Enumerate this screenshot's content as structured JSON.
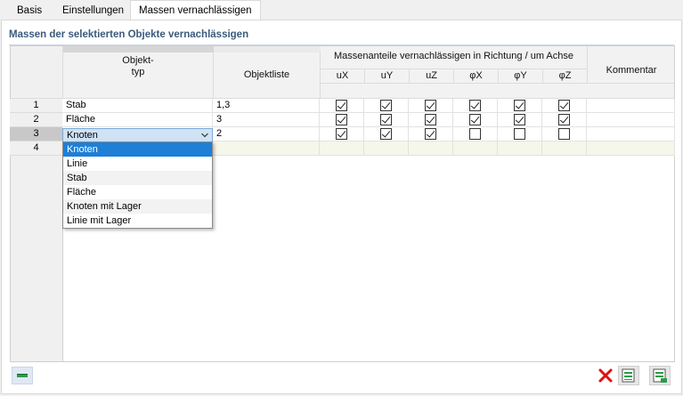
{
  "tabs": [
    {
      "label": "Basis",
      "active": false
    },
    {
      "label": "Einstellungen",
      "active": false
    },
    {
      "label": "Massen vernachlässigen",
      "active": true
    }
  ],
  "section_title": "Massen der selektierten Objekte vernachlässigen",
  "table": {
    "headers": {
      "objekttyp": "Objekt-\ntyp",
      "objektliste": "Objektliste",
      "group": "Massenanteile vernachlässigen in Richtung / um Achse",
      "ux": "uX",
      "uy": "uY",
      "uz": "uZ",
      "phix": "φX",
      "phiy": "φY",
      "phiz": "φZ",
      "kommentar": "Kommentar"
    },
    "rows": [
      {
        "num": "1",
        "typ": "Stab",
        "liste": "1,3",
        "checks": [
          true,
          true,
          true,
          true,
          true,
          true
        ],
        "kommentar": ""
      },
      {
        "num": "2",
        "typ": "Fläche",
        "liste": "3",
        "checks": [
          true,
          true,
          true,
          true,
          true,
          true
        ],
        "kommentar": ""
      },
      {
        "num": "3",
        "typ": "Knoten",
        "liste": "2",
        "checks": [
          true,
          true,
          true,
          false,
          false,
          false
        ],
        "kommentar": ""
      },
      {
        "num": "4",
        "typ": "",
        "liste": "",
        "checks": null,
        "kommentar": ""
      }
    ]
  },
  "combo": {
    "value": "Knoten"
  },
  "dropdown_options": [
    "Knoten",
    "Linie",
    "Stab",
    "Fläche",
    "Knoten mit Lager",
    "Linie mit Lager"
  ],
  "dropdown_selected": "Knoten",
  "colors": {
    "accent": "#1e7fd6",
    "title": "#3b5a7c",
    "delete": "#e01010",
    "green_icon": "#2e9a4a"
  },
  "icons": {
    "bottom_left": "table-view-icon",
    "delete": "delete-icon",
    "export": "export-icon",
    "import": "import-icon"
  }
}
